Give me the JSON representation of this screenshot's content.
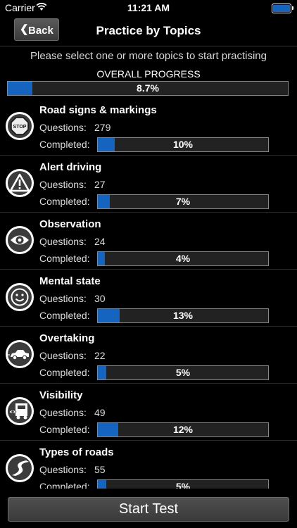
{
  "status_bar": {
    "carrier": "Carrier",
    "time": "11:21 AM"
  },
  "nav": {
    "back_label": "Back",
    "title": "Practice by Topics"
  },
  "instruction": "Please select one or more topics to start practising",
  "overall": {
    "label": "OVERALL PROGRESS",
    "percent": 8.7,
    "percent_text": "8.7%"
  },
  "labels": {
    "questions": "Questions:",
    "completed": "Completed:"
  },
  "topics": [
    {
      "title": "Road signs & markings",
      "questions": "279",
      "completed": 10,
      "completed_text": "10%",
      "icon": "stop-sign-icon"
    },
    {
      "title": "Alert driving",
      "questions": "27",
      "completed": 7,
      "completed_text": "7%",
      "icon": "warning-triangle-icon"
    },
    {
      "title": "Observation",
      "questions": "24",
      "completed": 4,
      "completed_text": "4%",
      "icon": "eye-icon"
    },
    {
      "title": "Mental state",
      "questions": "30",
      "completed": 13,
      "completed_text": "13%",
      "icon": "smiley-face-icon"
    },
    {
      "title": "Overtaking",
      "questions": "22",
      "completed": 5,
      "completed_text": "5%",
      "icon": "car-icon"
    },
    {
      "title": "Visibility",
      "questions": "49",
      "completed": 12,
      "completed_text": "12%",
      "icon": "truck-icon"
    },
    {
      "title": "Types of roads",
      "questions": "55",
      "completed": 5,
      "completed_text": "5%",
      "icon": "winding-road-icon"
    }
  ],
  "start_button": "Start Test",
  "colors": {
    "progress_fill": "#1565c0",
    "background": "#000000"
  }
}
